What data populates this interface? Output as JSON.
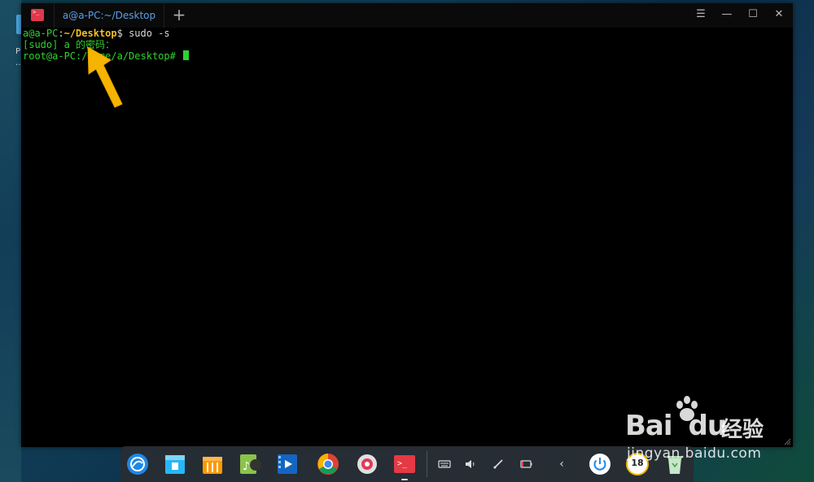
{
  "desktop": {
    "side_text_1": "P",
    "side_text_2": "…e"
  },
  "terminal": {
    "app_icon_glyph": ">_",
    "tab_title": "a@a-PC:~/Desktop",
    "add_tab": "+",
    "buttons": {
      "menu": "☰",
      "minimize": "—",
      "maximize": "☐",
      "close": "✕"
    },
    "lines": {
      "l1_user": "a@a-PC",
      "l1_sep": ":",
      "l1_path": "~/Desktop",
      "l1_prompt": "$ ",
      "l1_cmd": "sudo -s",
      "l2": "[sudo] a 的密码：",
      "l3": "root@a-PC:/home/a/Desktop# "
    }
  },
  "dock": {
    "apps": [
      "launcher-icon",
      "file-manager-icon",
      "app-store-icon",
      "music-icon",
      "video-icon",
      "chrome-icon",
      "settings-icon",
      "terminal-icon"
    ],
    "tray_chevron": "‹",
    "clock_text": "18"
  },
  "watermark": {
    "brand": "Bai",
    "brand_suffix": "du",
    "cn": "经验",
    "url": "jingyan.baidu.com"
  },
  "colors": {
    "prompt_green": "#2fd22f",
    "path_yellow": "#f0c020",
    "tab_blue": "#5aa0e8",
    "arrow": "#f5b400"
  }
}
